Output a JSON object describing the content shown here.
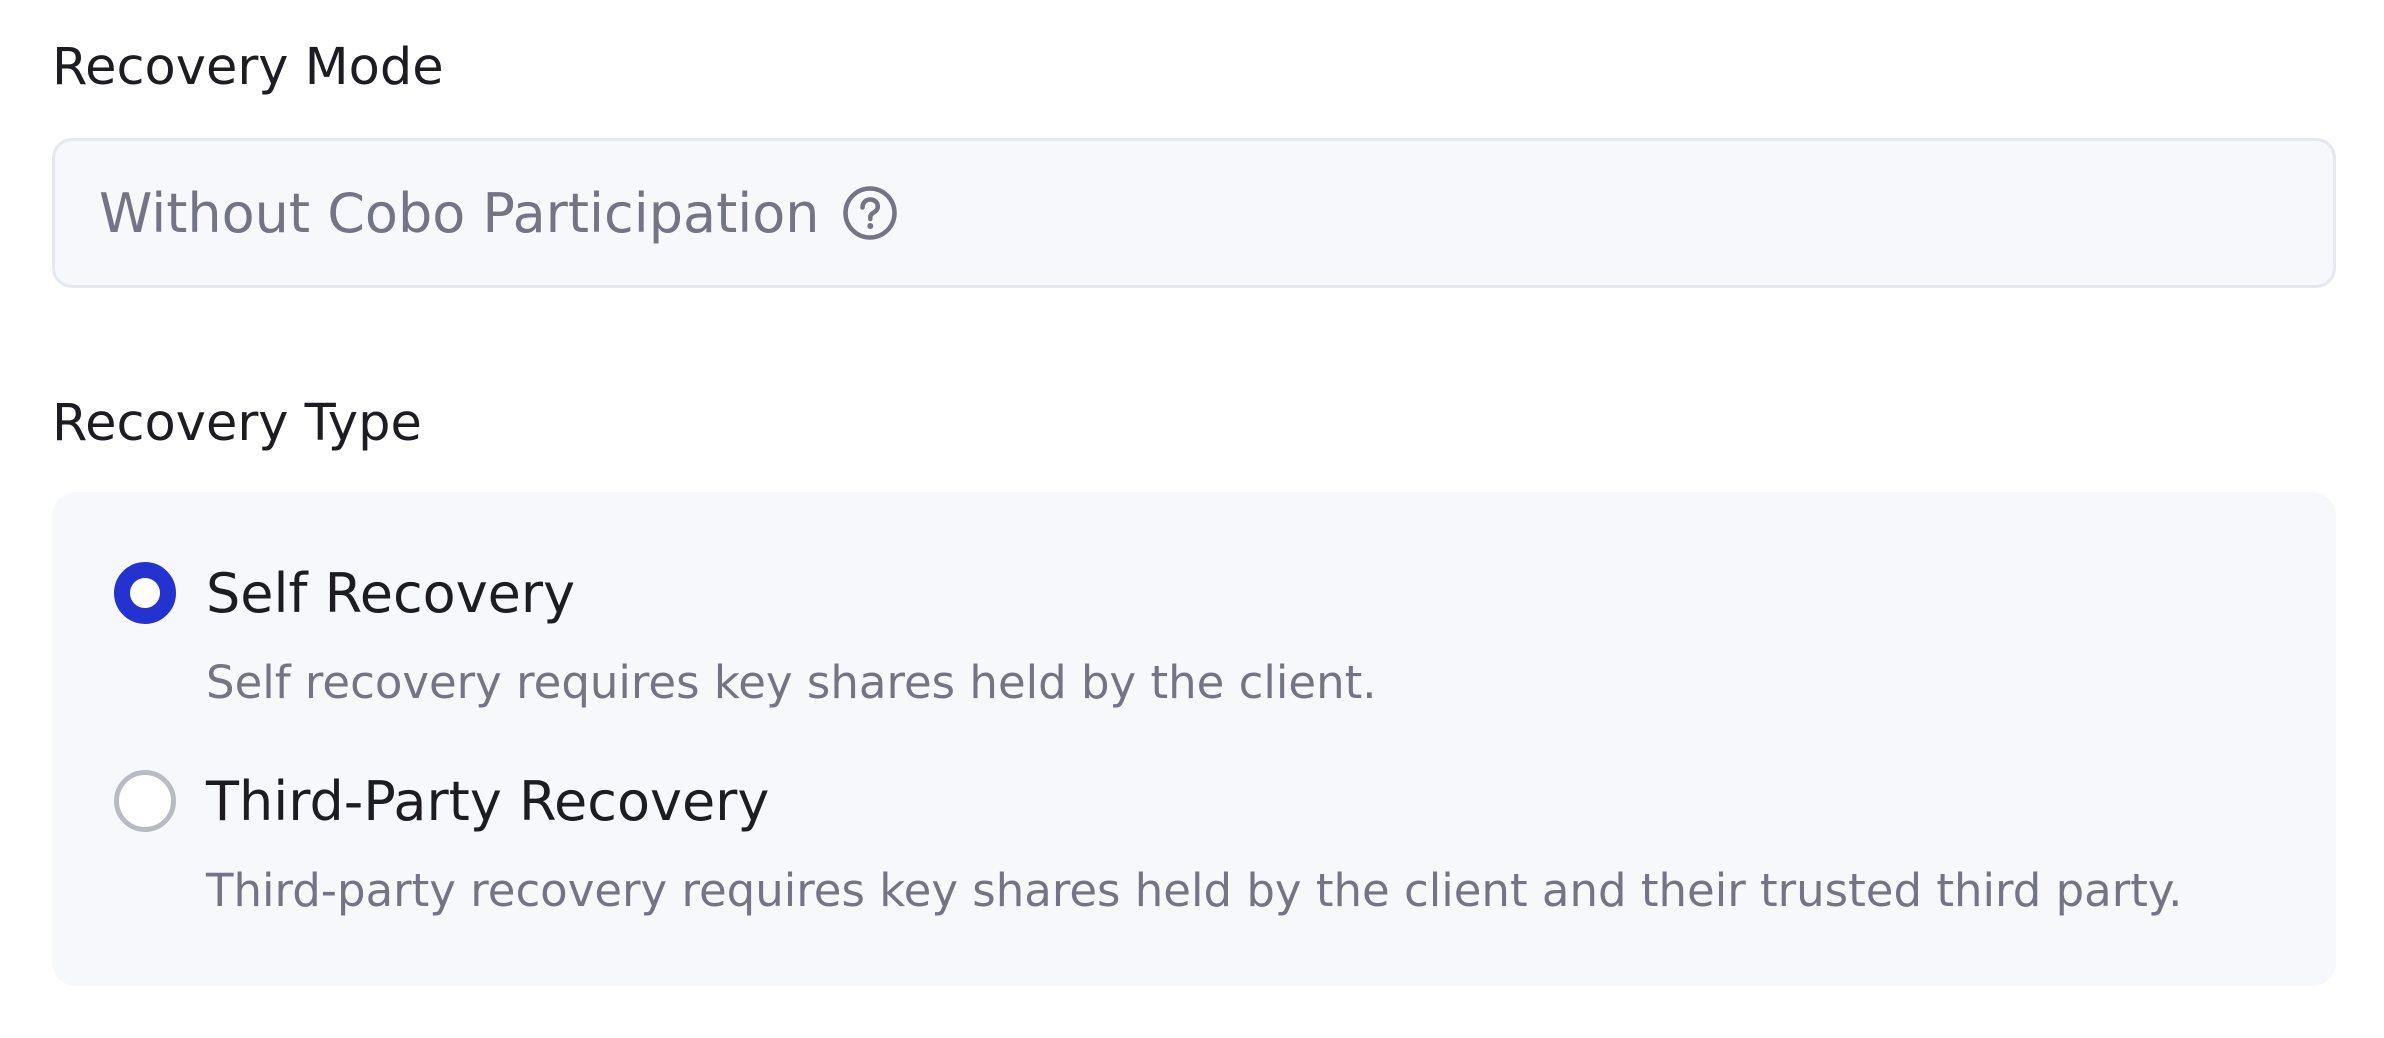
{
  "recovery_mode": {
    "label": "Recovery Mode",
    "value": "Without Cobo Participation",
    "help_icon": "question-circle-icon"
  },
  "recovery_type": {
    "label": "Recovery Type",
    "selected": "self",
    "options": [
      {
        "id": "self",
        "title": "Self Recovery",
        "description": "Self recovery requires key shares held by the client.",
        "checked": true
      },
      {
        "id": "third_party",
        "title": "Third-Party Recovery",
        "description": "Third-party recovery requires key shares held by the client and their trusted third party.",
        "checked": false
      }
    ]
  },
  "colors": {
    "accent": "#2433cf",
    "field_background": "#f7f8fc",
    "field_border": "#e6e8f0",
    "muted_text": "#737585",
    "primary_text": "#1c1c22",
    "radio_unchecked_border": "#b9bbc4"
  }
}
